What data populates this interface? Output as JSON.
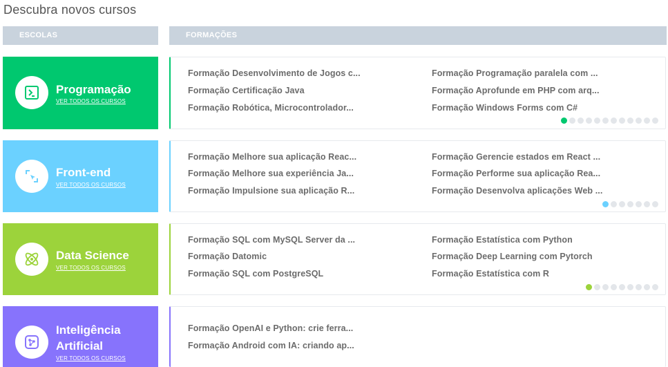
{
  "page": {
    "title": "Descubra novos cursos"
  },
  "headers": {
    "schools": "ESCOLAS",
    "trainings": "FORMAÇÕES"
  },
  "see_all_label": "VER TODOS OS CURSOS",
  "schools": [
    {
      "name": "Programação",
      "icon": "terminal-icon",
      "color": "#00c86f",
      "courses": [
        "Formação Desenvolvimento de Jogos c...",
        "Formação Programação paralela com ...",
        "Formação Certificação Java",
        "Formação Aprofunde em PHP com arq...",
        "Formação Robótica, Microcontrolador...",
        "Formação Windows Forms com C#"
      ],
      "pages": 12,
      "active_page": 1
    },
    {
      "name": "Front-end",
      "icon": "cursor-select-icon",
      "color": "#6bd1ff",
      "courses": [
        "Formação Melhore sua aplicação Reac...",
        "Formação Gerencie estados em React ...",
        "Formação Melhore sua experiência Ja...",
        "Formação Performe sua aplicação Rea...",
        "Formação Impulsione sua aplicação R...",
        "Formação Desenvolva aplicações Web ..."
      ],
      "pages": 7,
      "active_page": 1
    },
    {
      "name": "Data Science",
      "icon": "atom-icon",
      "color": "#9cd33b",
      "courses": [
        "Formação SQL com MySQL Server da ...",
        "Formação Estatística com Python",
        "Formação Datomic",
        "Formação Deep Learning com Pytorch",
        "Formação SQL com PostgreSQL",
        "Formação Estatística com R"
      ],
      "pages": 9,
      "active_page": 1
    },
    {
      "name": "Inteligência Artificial",
      "name_lines": [
        "Inteligência",
        "Artificial"
      ],
      "icon": "network-icon",
      "color": "#8773fc",
      "courses": [
        "Formação OpenAI e Python: crie ferra...",
        "Formação Android com IA: criando ap..."
      ]
    }
  ]
}
